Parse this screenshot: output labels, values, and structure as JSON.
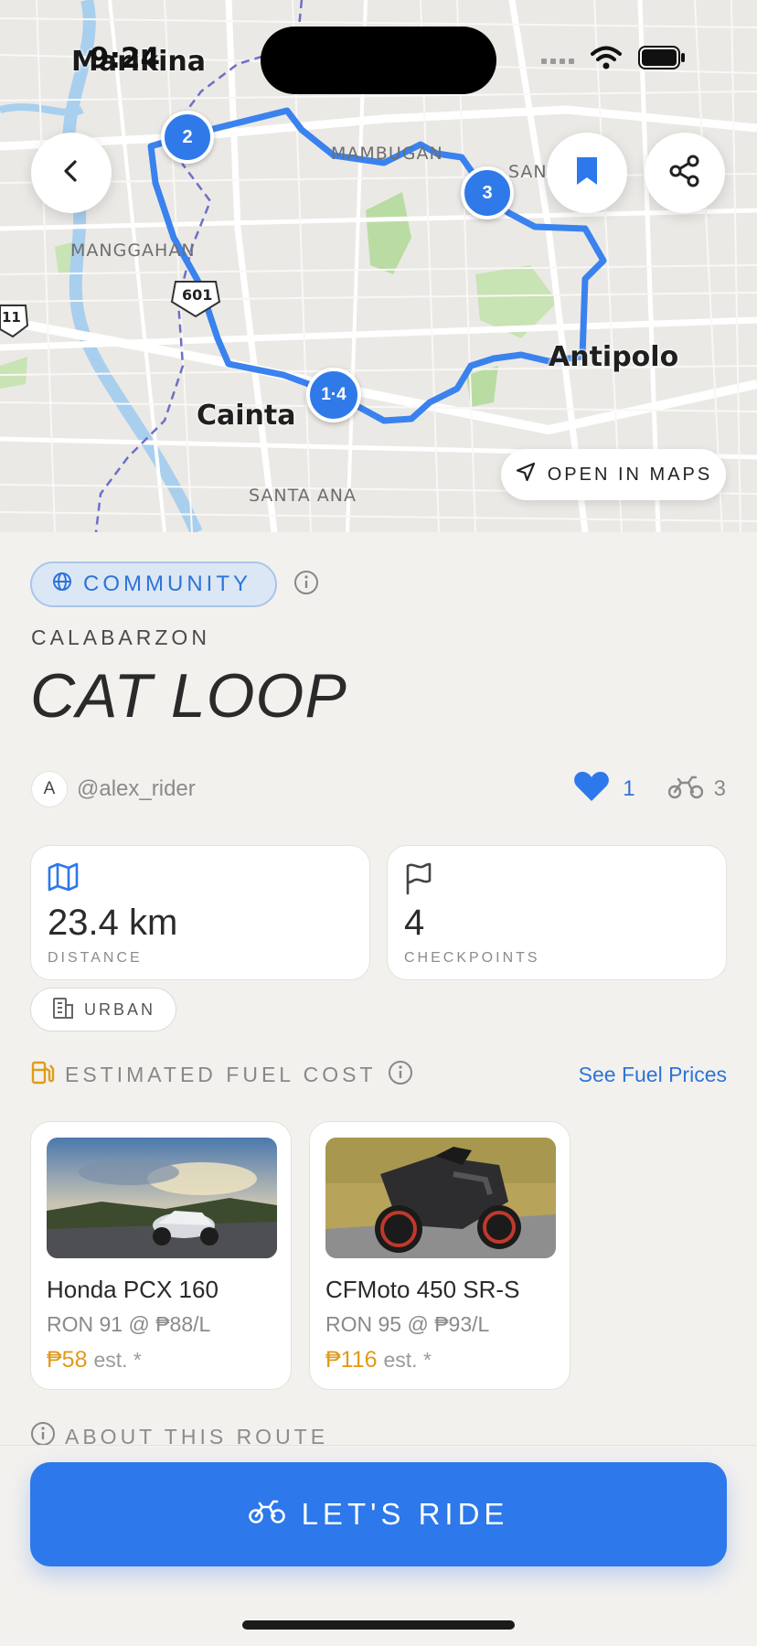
{
  "status_bar": {
    "time": "9:24"
  },
  "map": {
    "place_labels": {
      "manggahan": "MANGGAHAN",
      "mambugan": "MAMBUGAN",
      "san_roque": "SAN ROQUE",
      "santa_ana": "SANTA ANA",
      "marikina": "Marikina",
      "cainta": "Cainta",
      "antipolo": "Antipolo",
      "road_601": "601",
      "road_11": "11"
    },
    "checkpoints": [
      {
        "label": "2"
      },
      {
        "label": "3"
      },
      {
        "label": "1·4"
      }
    ],
    "open_maps_label": "OPEN IN MAPS",
    "route_color": "#3a82ee"
  },
  "route": {
    "visibility_badge": "COMMUNITY",
    "region": "CALABARZON",
    "title": "CAT LOOP",
    "author_initial": "A",
    "author": "@alex_rider",
    "likes": "1",
    "rides": "3"
  },
  "stats": {
    "distance": {
      "value": "23.4 km",
      "label": "DISTANCE"
    },
    "checkpoints": {
      "value": "4",
      "label": "CHECKPOINTS"
    },
    "terrain": "URBAN"
  },
  "fuel": {
    "title": "ESTIMATED FUEL COST",
    "link": "See Fuel Prices",
    "bikes": [
      {
        "name": "Honda PCX 160",
        "fuel": "RON 91 @ ₱88/L",
        "cost": "₱58",
        "est": "est. *"
      },
      {
        "name": "CFMoto 450 SR-S",
        "fuel": "RON 95 @ ₱93/L",
        "cost": "₱116",
        "est": "est. *"
      }
    ]
  },
  "about": {
    "title": "ABOUT THIS ROUTE"
  },
  "cta": {
    "label": "LET'S RIDE"
  },
  "colors": {
    "accent": "#2d78ea",
    "fuel_cost": "#e09b19",
    "background": "#f3f1ee"
  }
}
